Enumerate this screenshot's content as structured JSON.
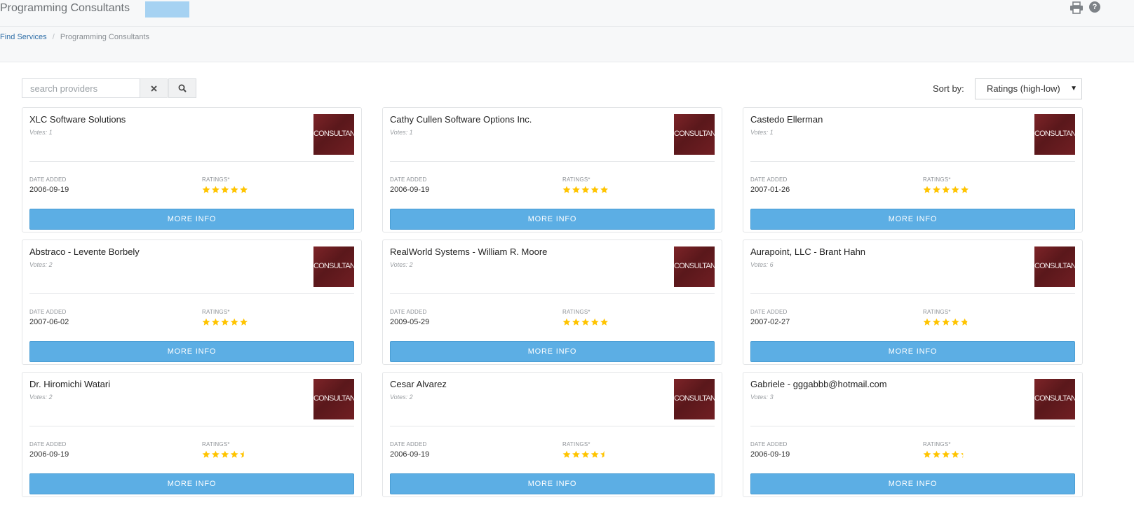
{
  "header": {
    "title": "Programming Consultants",
    "print_icon": "printer-icon",
    "help_icon": "help-icon",
    "help_glyph": "?"
  },
  "breadcrumb": {
    "link": "Find Services",
    "separator": "/",
    "current": "Programming Consultants"
  },
  "search": {
    "placeholder": "search providers",
    "value": "",
    "clear_icon": "close-icon",
    "search_icon": "search-icon"
  },
  "sort": {
    "label": "Sort by:",
    "selected": "Ratings (high-low)",
    "caret": "▼"
  },
  "colors": {
    "accent": "#5caee4",
    "star": "#ffc400",
    "badge": "#a6d2f2"
  },
  "card_labels": {
    "date_added": "DATE ADDED",
    "ratings": "RATINGS*",
    "more_info": "MORE INFO",
    "thumbnail_text": "CONSULTANT"
  },
  "providers": [
    {
      "name": "XLC Software Solutions",
      "votes": "Votes: 1",
      "date": "2006-09-19",
      "rating": 5
    },
    {
      "name": "Cathy Cullen Software Options Inc.",
      "votes": "Votes: 1",
      "date": "2006-09-19",
      "rating": 5
    },
    {
      "name": "Castedo Ellerman",
      "votes": "Votes: 1",
      "date": "2007-01-26",
      "rating": 5
    },
    {
      "name": "Abstraco - Levente Borbely",
      "votes": "Votes: 2",
      "date": "2007-06-02",
      "rating": 5
    },
    {
      "name": "RealWorld Systems - William R. Moore",
      "votes": "Votes: 2",
      "date": "2009-05-29",
      "rating": 5
    },
    {
      "name": "Aurapoint, LLC - Brant Hahn",
      "votes": "Votes: 6",
      "date": "2007-02-27",
      "rating": 4.8
    },
    {
      "name": "Dr. Hiromichi Watari",
      "votes": "Votes: 2",
      "date": "2006-09-19",
      "rating": 4.5
    },
    {
      "name": "Cesar Alvarez",
      "votes": "Votes: 2",
      "date": "2006-09-19",
      "rating": 4.5
    },
    {
      "name": "Gabriele - gggabbb@hotmail.com",
      "votes": "Votes: 3",
      "date": "2006-09-19",
      "rating": 4.3
    }
  ]
}
